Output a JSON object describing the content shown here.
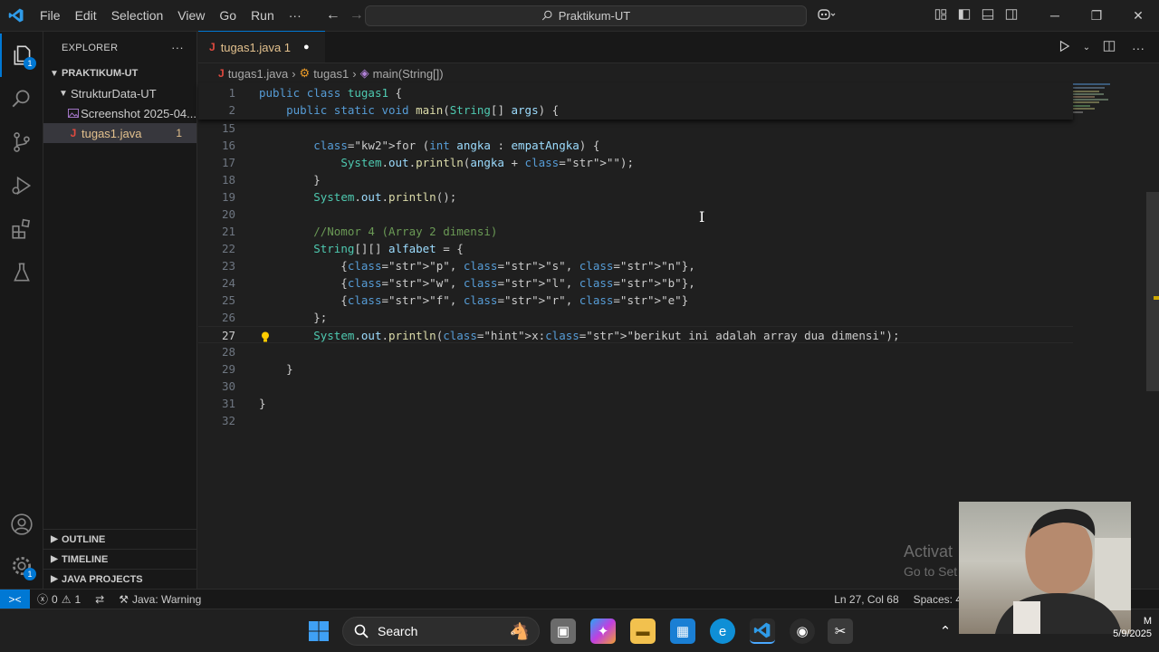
{
  "titlebar": {
    "menu": [
      "File",
      "Edit",
      "Selection",
      "View",
      "Go",
      "Run",
      "···"
    ],
    "command_center": "Praktikum-UT"
  },
  "explorer": {
    "title": "EXPLORER",
    "more": "···",
    "root": "PRAKTIKUM-UT",
    "folder": "StrukturData-UT",
    "items": [
      {
        "label": "Screenshot 2025-04...",
        "badge": ""
      },
      {
        "label": "tugas1.java",
        "badge": "1"
      }
    ],
    "sections": [
      "OUTLINE",
      "TIMELINE",
      "JAVA PROJECTS"
    ]
  },
  "activity_badges": {
    "explorer": "1",
    "settings": "1"
  },
  "tab": {
    "label": "tugas1.java 1",
    "modified_dot": "●"
  },
  "breadcrumb": {
    "file": "tugas1.java",
    "class": "tugas1",
    "method": "main(String[])"
  },
  "code": {
    "cursor_line": "27",
    "sticky": [
      {
        "n": "1",
        "t": "public class tugas1 {"
      },
      {
        "n": "2",
        "t": "    public static void main(String[] args) {"
      }
    ],
    "lines": [
      {
        "n": "15",
        "t": ""
      },
      {
        "n": "16",
        "t": "        for (int angka : empatAngka) {"
      },
      {
        "n": "17",
        "t": "            System.out.println(angka + \"\");"
      },
      {
        "n": "18",
        "t": "        }"
      },
      {
        "n": "19",
        "t": "        System.out.println();"
      },
      {
        "n": "20",
        "t": ""
      },
      {
        "n": "21",
        "t": "        //Nomor 4 (Array 2 dimensi)"
      },
      {
        "n": "22",
        "t": "        String[][] alfabet = {"
      },
      {
        "n": "23",
        "t": "            {\"p\", \"s\", \"n\"},"
      },
      {
        "n": "24",
        "t": "            {\"w\", \"l\", \"b\"},"
      },
      {
        "n": "25",
        "t": "            {\"f\", \"r\", \"e\"}"
      },
      {
        "n": "26",
        "t": "        };"
      },
      {
        "n": "27",
        "t": "        System.out.println(x:\"berikut ini adalah array dua dimensi\");"
      },
      {
        "n": "28",
        "t": ""
      },
      {
        "n": "29",
        "t": "    }"
      },
      {
        "n": "30",
        "t": ""
      },
      {
        "n": "31",
        "t": "}"
      },
      {
        "n": "32",
        "t": ""
      }
    ]
  },
  "statusbar": {
    "remote": "><",
    "errors": "0",
    "warnings": "1",
    "java_status": "Java: Warning",
    "position": "Ln 27, Col 68",
    "spaces": "Spaces: 4"
  },
  "watermark": {
    "line1": "Activat",
    "line2": "Go to Set"
  },
  "taskbar": {
    "search": "Search",
    "time": "M",
    "date": "5/9/2025"
  }
}
